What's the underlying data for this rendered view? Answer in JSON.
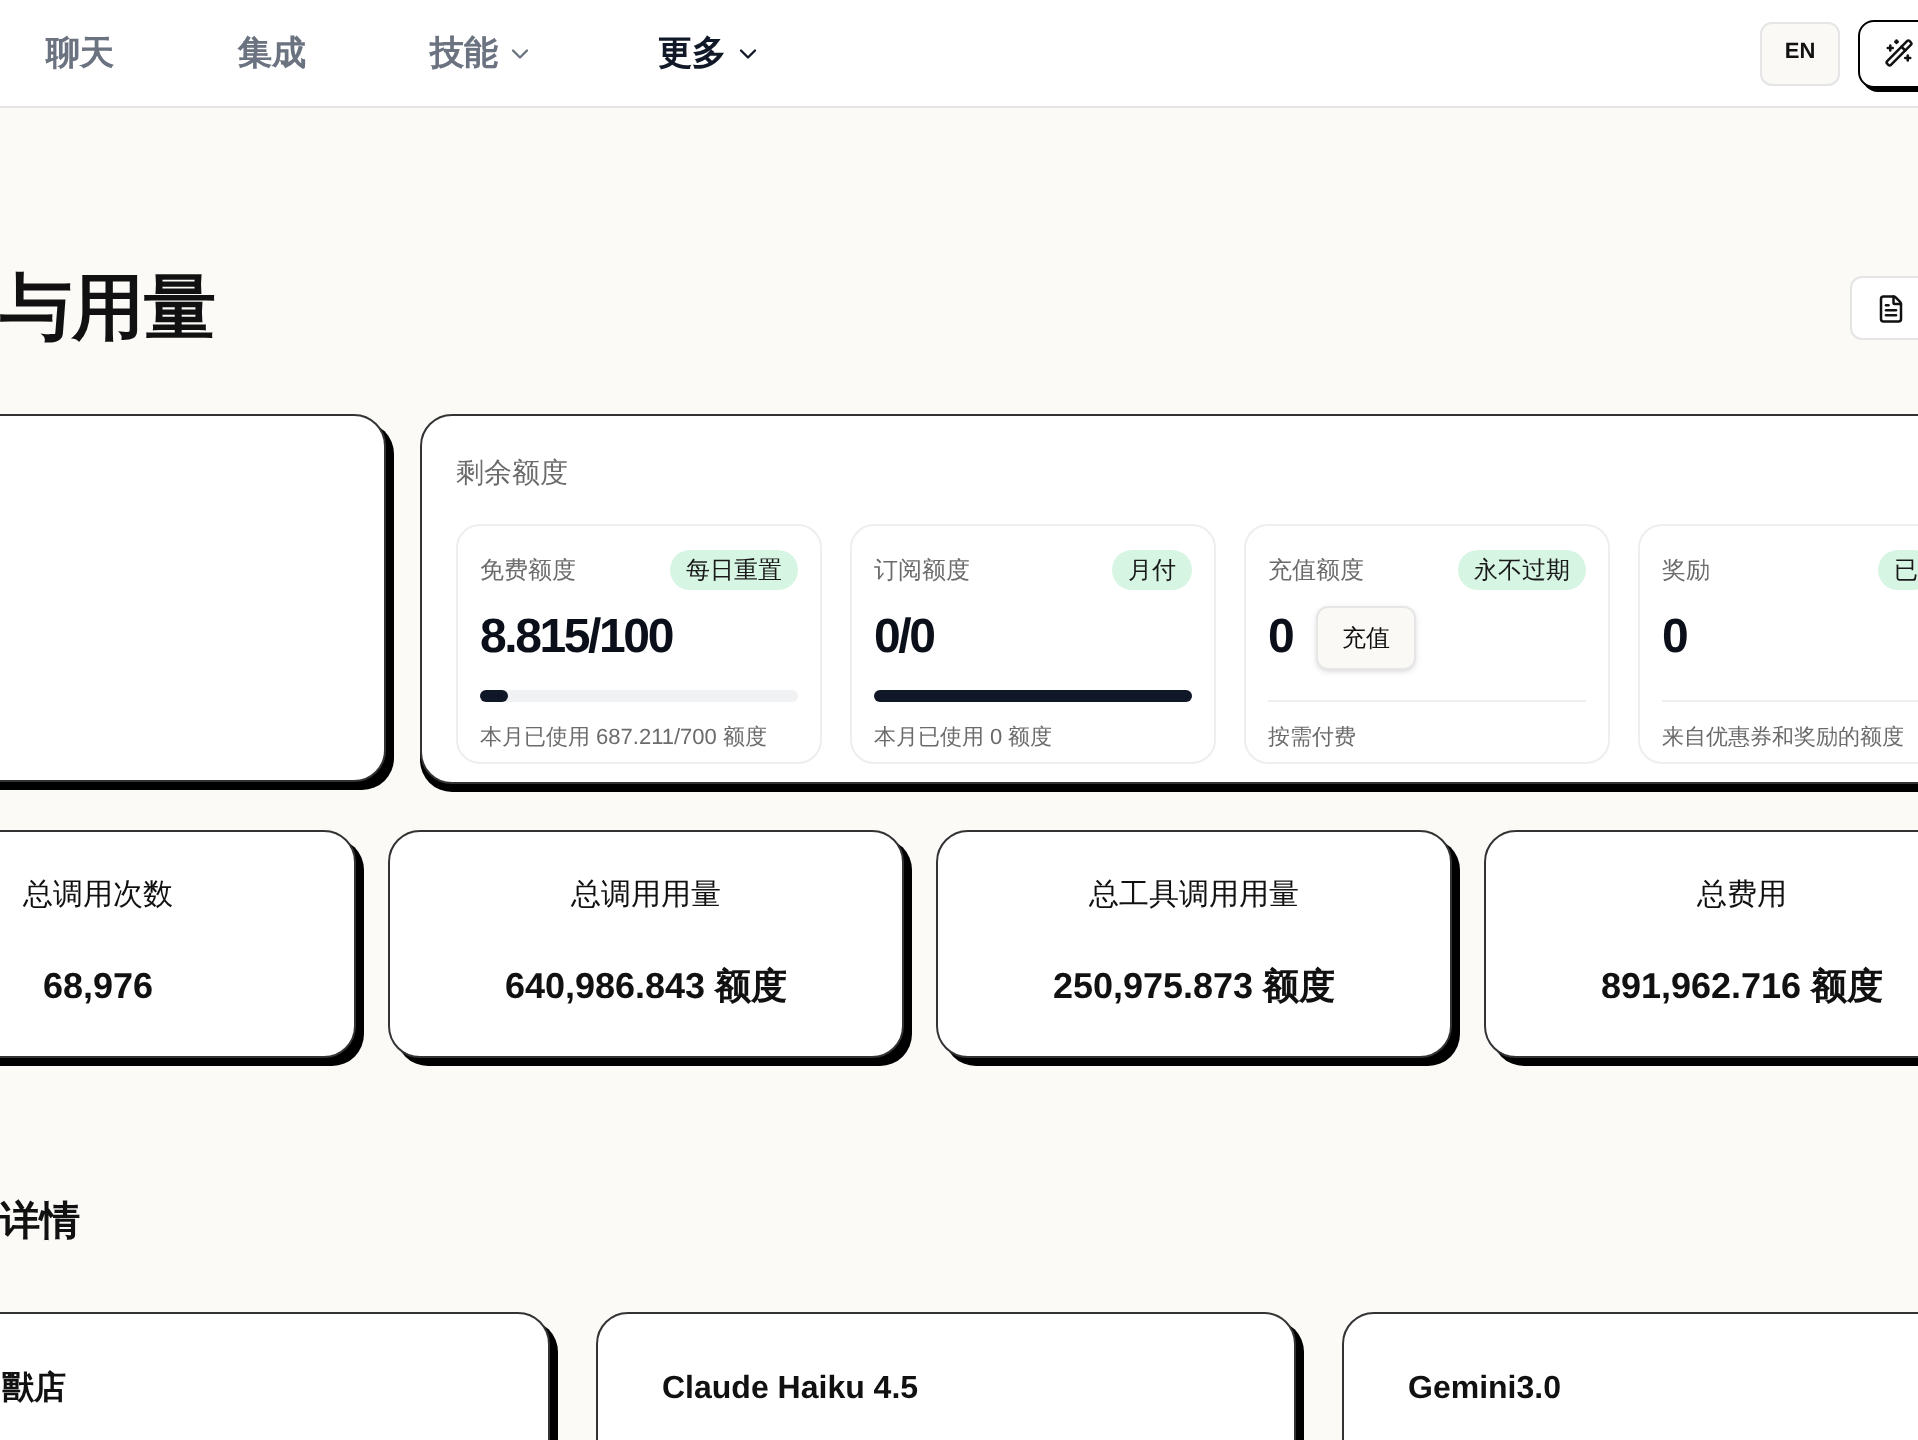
{
  "nav": {
    "items": [
      {
        "label": "聊天",
        "selected": false,
        "has_menu": false
      },
      {
        "label": "集成",
        "selected": false,
        "has_menu": false
      },
      {
        "label": "技能",
        "selected": false,
        "has_menu": true
      },
      {
        "label": "更多",
        "selected": true,
        "has_menu": true
      }
    ],
    "language": "EN"
  },
  "page": {
    "title": "与用量"
  },
  "quota_panel": {
    "title": "剩余额度",
    "cards": [
      {
        "kind": "progress",
        "label": "免费额度",
        "tag": "每日重置",
        "value": "8.815/100",
        "level": 0.09,
        "note": "本月已使用 687.211/700 额度"
      },
      {
        "kind": "progress",
        "label": "订阅额度",
        "tag": "月付",
        "value": "0/0",
        "level": 1,
        "note": "本月已使用 0 额度"
      },
      {
        "kind": "button",
        "label": "充值额度",
        "tag": "永不过期",
        "value": "0",
        "button": "充值",
        "note": "按需付费"
      },
      {
        "kind": "plain",
        "label": "奖励",
        "tag": "已",
        "value": "0",
        "note": "来自优惠券和奖励的额度"
      }
    ]
  },
  "stats": [
    {
      "label": "总调用次数",
      "value": "68,976"
    },
    {
      "label": "总调用用量",
      "value": "640,986.843 额度"
    },
    {
      "label": "总工具调用用量",
      "value": "250,975.873 额度"
    },
    {
      "label": "总费用",
      "value": "891,962.716 额度"
    }
  ],
  "section_title": "详情",
  "models": [
    {
      "name": "獸店"
    },
    {
      "name": "Claude Haiku 4.5"
    },
    {
      "name": "Gemini3.0"
    }
  ]
}
